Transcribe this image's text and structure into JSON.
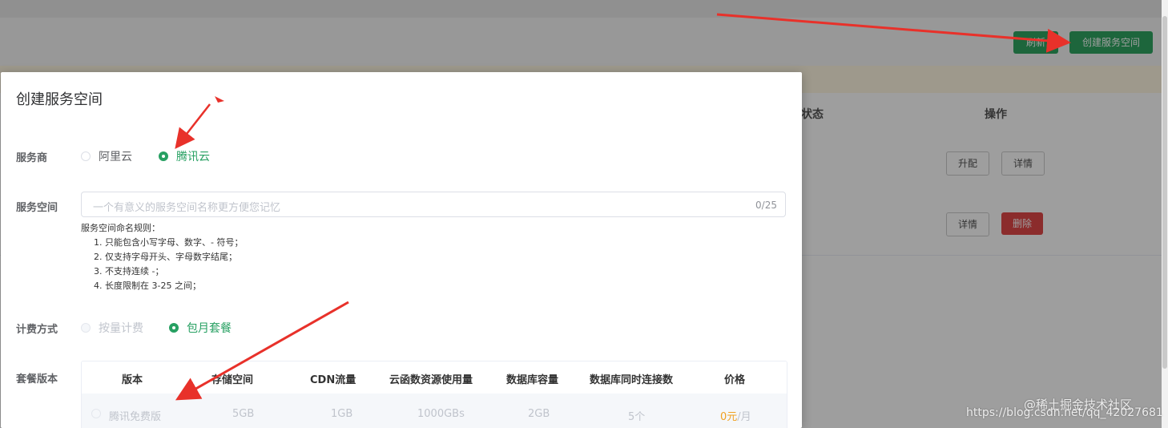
{
  "toolbar": {
    "refresh_label": "刷新",
    "create_label": "创建服务空间"
  },
  "table": {
    "status_header": "状态",
    "actions_header": "操作",
    "rows": [
      {
        "btn1": "升配",
        "btn2": "详情"
      },
      {
        "btn1": "详情",
        "btn2": "删除"
      }
    ]
  },
  "dialog": {
    "title": "创建服务空间",
    "provider_label": "服务商",
    "provider_options": [
      "阿里云",
      "腾讯云"
    ],
    "provider_selected": "腾讯云",
    "space_label": "服务空间",
    "space_placeholder": "一个有意义的服务空间名称更方便您记忆",
    "space_count": "0/25",
    "rules_title": "服务空间命名规则：",
    "rules": [
      "1. 只能包含小写字母、数字、- 符号；",
      "2. 仅支持字母开头、字母数字结尾；",
      "3. 不支持连续 -；",
      "4. 长度限制在 3-25 之间；"
    ],
    "billing_label": "计费方式",
    "billing_options": [
      "按量计费",
      "包月套餐"
    ],
    "billing_selected": "包月套餐",
    "package_label": "套餐版本",
    "package_table": {
      "headers": [
        "版本",
        "存储空间",
        "CDN流量",
        "云函数资源使用量",
        "数据库容量",
        "数据库同时连接数",
        "价格"
      ],
      "row": {
        "name": "腾讯免费版",
        "storage": "5GB",
        "cdn": "1GB",
        "fn": "1000GBs",
        "db": "2GB",
        "conn": "5个",
        "price_num": "0元",
        "price_unit": "/月"
      }
    }
  },
  "watermark": {
    "line1": "@稀土掘金技术社区",
    "line2": "https://blog.csdn.net/qq_42027681"
  },
  "colors": {
    "primary": "#27a062",
    "danger": "#e04848",
    "arrow": "#e8312a"
  }
}
